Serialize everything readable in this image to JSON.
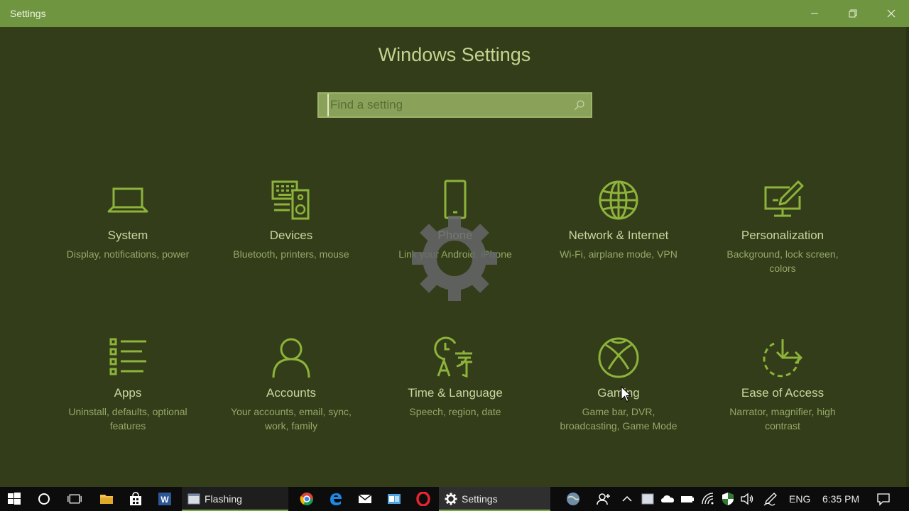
{
  "window": {
    "title": "Settings",
    "controls": {
      "minimize": "minimize",
      "restore": "restore",
      "close": "close"
    }
  },
  "page": {
    "title": "Windows Settings",
    "search_placeholder": "Find a setting"
  },
  "tiles": [
    {
      "title": "System",
      "desc": "Display, notifications, power",
      "icon": "laptop-icon"
    },
    {
      "title": "Devices",
      "desc": "Bluetooth, printers, mouse",
      "icon": "keyboard-speaker-icon"
    },
    {
      "title": "Phone",
      "desc": "Link your Android, iPhone",
      "icon": "phone-icon"
    },
    {
      "title": "Network & Internet",
      "desc": "Wi-Fi, airplane mode, VPN",
      "icon": "globe-icon"
    },
    {
      "title": "Personalization",
      "desc": "Background, lock screen, colors",
      "icon": "paint-monitor-icon"
    },
    {
      "title": "Apps",
      "desc": "Uninstall, defaults, optional features",
      "icon": "apps-list-icon"
    },
    {
      "title": "Accounts",
      "desc": "Your accounts, email, sync, work, family",
      "icon": "person-icon"
    },
    {
      "title": "Time & Language",
      "desc": "Speech, region, date",
      "icon": "clock-language-icon"
    },
    {
      "title": "Gaming",
      "desc": "Game bar, DVR, broadcasting, Game Mode",
      "icon": "xbox-icon"
    },
    {
      "title": "Ease of Access",
      "desc": "Narrator, magnifier, high contrast",
      "icon": "ease-of-access-icon"
    }
  ],
  "taskbar": {
    "open_apps": [
      {
        "label": "Flashing",
        "icon": "window-icon"
      },
      {
        "label": "Settings",
        "icon": "gear-icon"
      }
    ],
    "language": "ENG",
    "time": "6:35 PM"
  },
  "colors": {
    "titlebar": "#6f9540",
    "background": "#333d19",
    "accent": "#79a847",
    "taskbar": "#0c0c0c"
  }
}
